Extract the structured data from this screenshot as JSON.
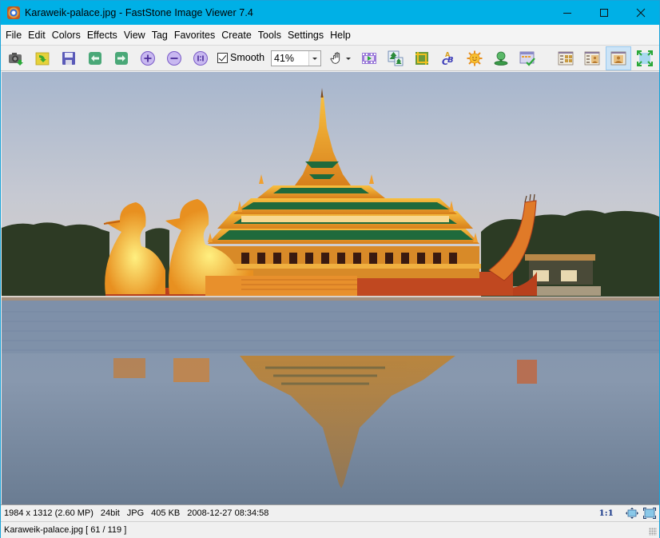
{
  "window": {
    "title": "Karaweik-palace.jpg  -  FastStone Image Viewer 7.4",
    "controls": {
      "minimize": "—",
      "maximize": "☐",
      "close": "✕"
    }
  },
  "menu": [
    "File",
    "Edit",
    "Colors",
    "Effects",
    "View",
    "Tag",
    "Favorites",
    "Create",
    "Tools",
    "Settings",
    "Help"
  ],
  "toolbar": {
    "buttons": [
      {
        "name": "acquire-camera",
        "icon": "camera-download-icon"
      },
      {
        "name": "open-folder",
        "icon": "folder-open-icon"
      },
      {
        "name": "save",
        "icon": "floppy-disk-icon"
      },
      {
        "name": "previous",
        "icon": "arrow-left-icon"
      },
      {
        "name": "next",
        "icon": "arrow-right-icon"
      },
      {
        "name": "zoom-in",
        "icon": "zoom-in-icon"
      },
      {
        "name": "zoom-out",
        "icon": "zoom-out-icon"
      },
      {
        "name": "actual-size",
        "icon": "actual-size-icon"
      },
      {
        "name": "pan",
        "icon": "hand-icon"
      },
      {
        "name": "slideshow",
        "icon": "film-play-icon"
      },
      {
        "name": "resize",
        "icon": "resize-trees-icon"
      },
      {
        "name": "crop",
        "icon": "crop-icon"
      },
      {
        "name": "add-text",
        "icon": "text-abc-icon"
      },
      {
        "name": "adjust-lighting",
        "icon": "sun-icon"
      },
      {
        "name": "set-wallpaper",
        "icon": "stamp-icon"
      },
      {
        "name": "batch",
        "icon": "checklist-icon"
      },
      {
        "name": "browser-mode",
        "icon": "thumbnails-layout-icon"
      },
      {
        "name": "windowed-mode",
        "icon": "browser-preview-layout-icon"
      },
      {
        "name": "viewer-mode",
        "icon": "viewer-layout-icon"
      },
      {
        "name": "full-screen",
        "icon": "fullscreen-icon"
      }
    ],
    "smooth_label": "Smooth",
    "smooth_checked": true,
    "zoom_value": "41%"
  },
  "status": {
    "dimensions": "1984 x 1312 (2.60 MP)",
    "bit_depth": "24bit",
    "format": "JPG",
    "file_size": "405 KB",
    "date": "2008-12-27 08:34:58",
    "ratio_label": "1:1",
    "file_info": "Karaweik-palace.jpg [ 61 / 119 ]"
  },
  "image": {
    "subject": "Karaweik palace on a lake at sunset with reflection",
    "colors": {
      "sky_top": "#a9b6cc",
      "sky_bottom": "#d8d2cc",
      "gold": "#e8a032",
      "gold_light": "#f8c850",
      "roof_green": "#1f6a3c",
      "hull_red": "#b8401c",
      "trees": "#2a3a22",
      "water": "#7f93aa",
      "water_dark": "#64768c"
    }
  }
}
